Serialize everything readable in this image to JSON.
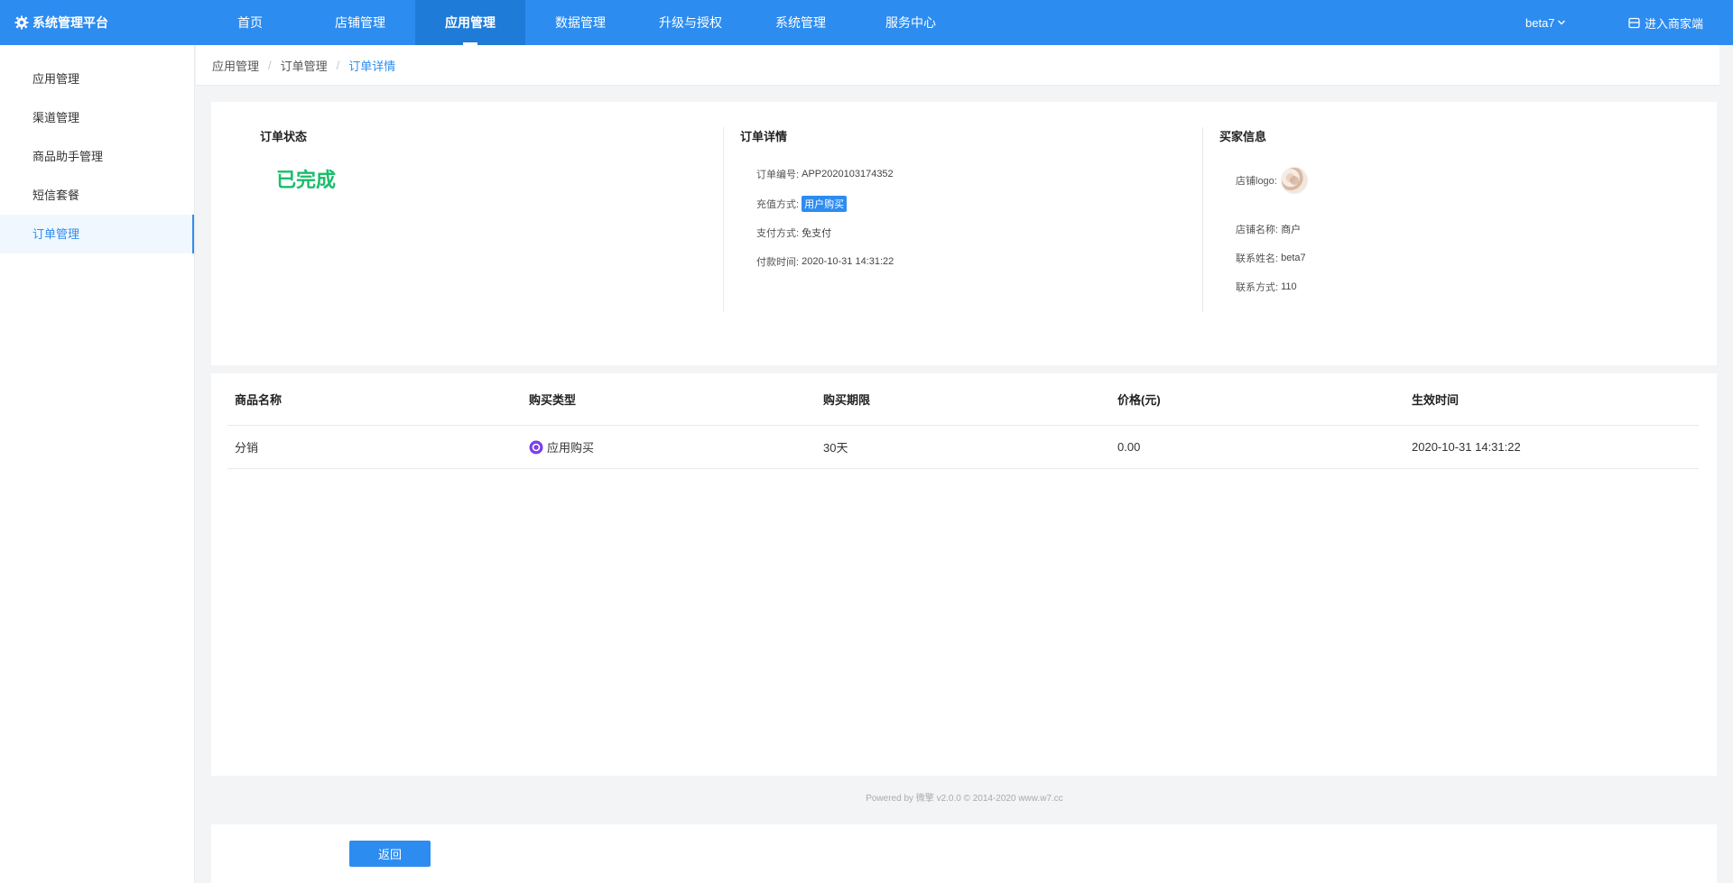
{
  "header": {
    "logo_text": "系统管理平台",
    "nav": [
      {
        "label": "首页",
        "active": false
      },
      {
        "label": "店铺管理",
        "active": false
      },
      {
        "label": "应用管理",
        "active": true
      },
      {
        "label": "数据管理",
        "active": false
      },
      {
        "label": "升级与授权",
        "active": false
      },
      {
        "label": "系统管理",
        "active": false
      },
      {
        "label": "服务中心",
        "active": false
      }
    ],
    "user": "beta7",
    "enter_merchant": "进入商家端"
  },
  "sidebar": {
    "items": [
      {
        "label": "应用管理"
      },
      {
        "label": "渠道管理"
      },
      {
        "label": "商品助手管理"
      },
      {
        "label": "短信套餐"
      },
      {
        "label": "订单管理",
        "active": true
      }
    ]
  },
  "breadcrumb": [
    "应用管理",
    "订单管理",
    "订单详情"
  ],
  "order_status": {
    "title": "订单状态",
    "value": "已完成"
  },
  "order_detail": {
    "title": "订单详情",
    "order_no_label": "订单编号:",
    "order_no": "APP2020103174352",
    "recharge_label": "充值方式:",
    "recharge": "用户购买",
    "pay_label": "支付方式:",
    "pay": "免支付",
    "pay_time_label": "付款时间:",
    "pay_time": "2020-10-31 14:31:22"
  },
  "buyer": {
    "title": "买家信息",
    "logo_label": "店铺logo:",
    "shop_name_label": "店铺名称:",
    "shop_name": "商户",
    "contact_name_label": "联系姓名:",
    "contact_name": "beta7",
    "contact_label": "联系方式:",
    "contact": "110"
  },
  "products": {
    "headers": [
      "商品名称",
      "购买类型",
      "购买期限",
      "价格(元)",
      "生效时间"
    ],
    "rows": [
      {
        "name": "分销",
        "type": "应用购买",
        "period": "30天",
        "price": "0.00",
        "effective": "2020-10-31 14:31:22"
      }
    ]
  },
  "footer": "Powered by 微擎 v2.0.0 © 2014-2020 www.w7.cc",
  "back_button": "返回",
  "colors": {
    "primary": "#2d8cf0",
    "success": "#19be6b",
    "purple": "#7b3fe4"
  }
}
